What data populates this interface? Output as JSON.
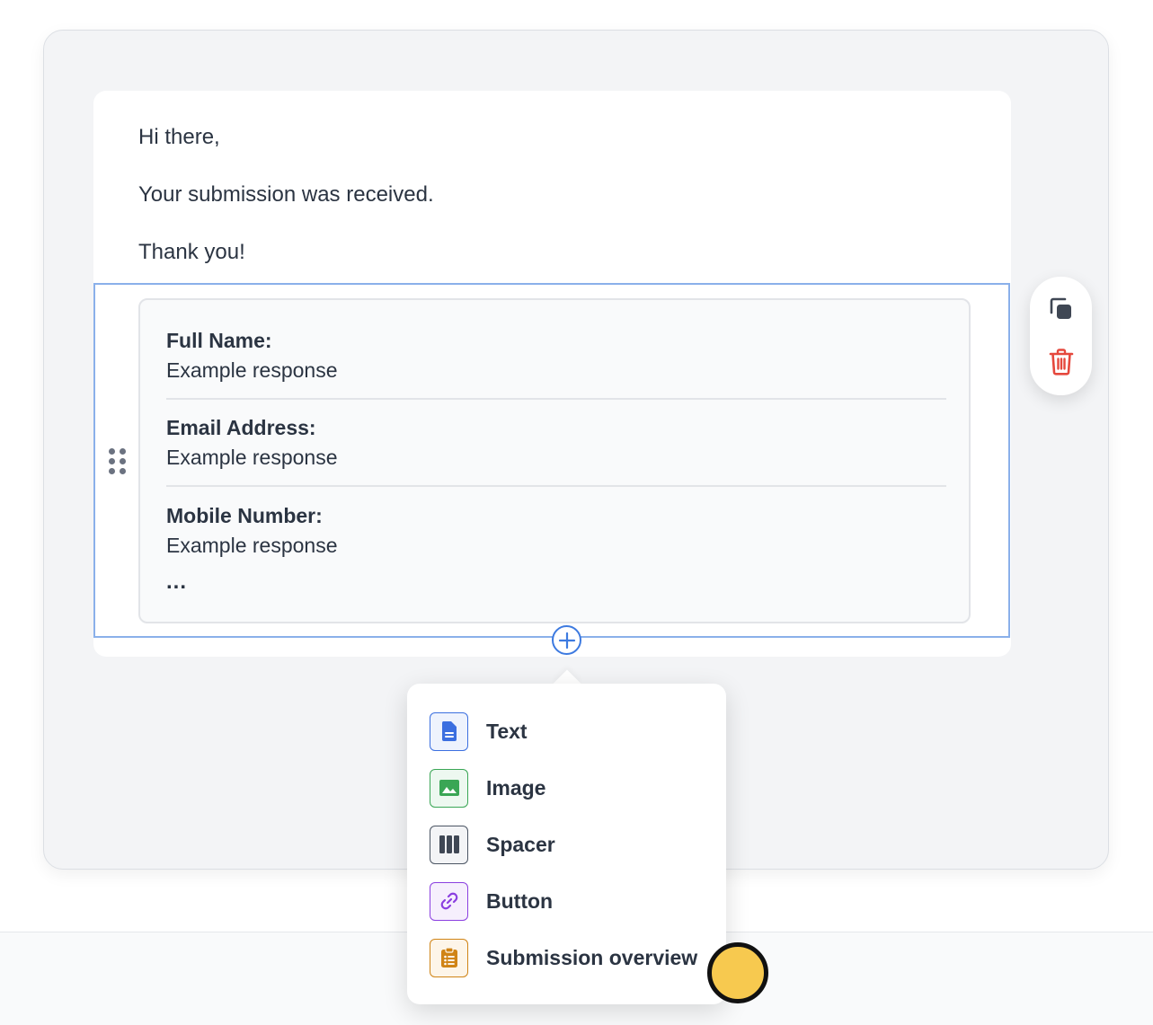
{
  "email": {
    "greeting": "Hi there,",
    "message": "Your submission was received.",
    "signoff": "Thank you!"
  },
  "submission_overview": {
    "fields": [
      {
        "label": "Full Name:",
        "value": "Example response"
      },
      {
        "label": "Email Address:",
        "value": "Example response"
      },
      {
        "label": "Mobile Number:",
        "value": "Example response"
      }
    ],
    "more": "..."
  },
  "block_actions": {
    "duplicate_icon": "duplicate-icon",
    "delete_icon": "trash-icon"
  },
  "add_block": {
    "icon": "plus-circle-icon",
    "menu_items": [
      {
        "label": "Text",
        "icon": "document-icon",
        "color": "#3b6fe0"
      },
      {
        "label": "Image",
        "icon": "image-icon",
        "color": "#3aa655"
      },
      {
        "label": "Spacer",
        "icon": "columns-icon",
        "color": "#4b5563"
      },
      {
        "label": "Button",
        "icon": "link-icon",
        "color": "#8b3fe0"
      },
      {
        "label": "Submission overview",
        "icon": "clipboard-list-icon",
        "color": "#d08416"
      }
    ]
  },
  "colors": {
    "selection_border": "#8ab0ea",
    "accent": "#3d7ae0",
    "delete": "#e5483d",
    "pointer_highlight": "#f7c94f"
  }
}
